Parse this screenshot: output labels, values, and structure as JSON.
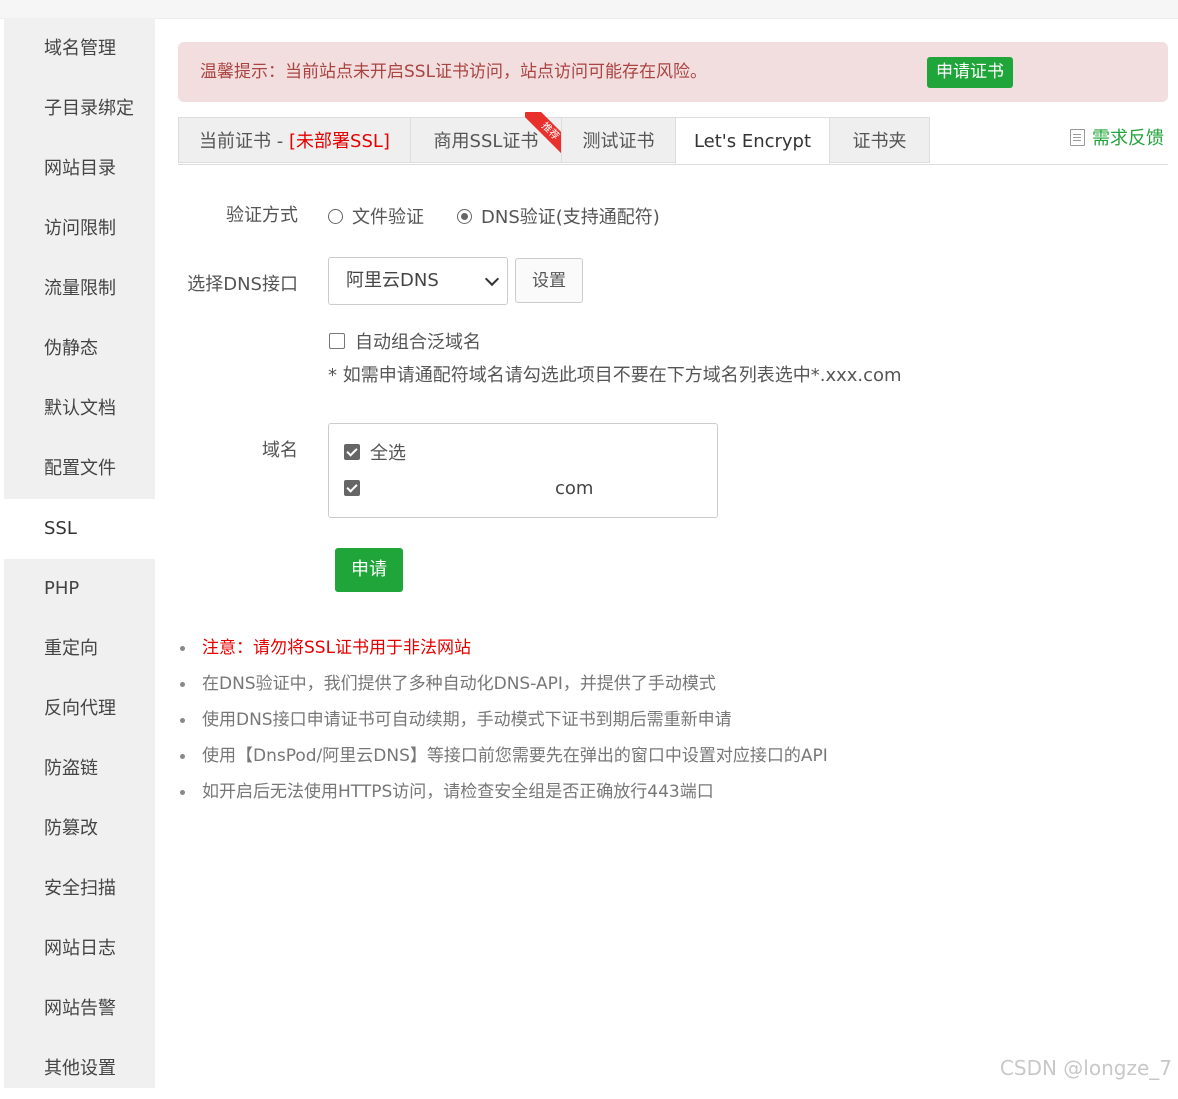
{
  "sidebar": {
    "items": [
      {
        "label": "域名管理"
      },
      {
        "label": "子目录绑定"
      },
      {
        "label": "网站目录"
      },
      {
        "label": "访问限制"
      },
      {
        "label": "流量限制"
      },
      {
        "label": "伪静态"
      },
      {
        "label": "默认文档"
      },
      {
        "label": "配置文件"
      },
      {
        "label": "SSL"
      },
      {
        "label": "PHP"
      },
      {
        "label": "重定向"
      },
      {
        "label": "反向代理"
      },
      {
        "label": "防盗链"
      },
      {
        "label": "防篡改"
      },
      {
        "label": "安全扫描"
      },
      {
        "label": "网站日志"
      },
      {
        "label": "网站告警"
      },
      {
        "label": "其他设置"
      }
    ],
    "active": "SSL"
  },
  "alert": {
    "text": "温馨提示：当前站点未开启SSL证书访问，站点访问可能存在风险。",
    "button": "申请证书"
  },
  "tabs": {
    "current_prefix": "当前证书 - ",
    "current_status": "[未部署SSL]",
    "commercial": "商用SSL证书",
    "commercial_badge": "推荐",
    "test": "测试证书",
    "letsencrypt": "Let's Encrypt",
    "folder": "证书夹",
    "active": "Let's Encrypt"
  },
  "feedback": {
    "label": "需求反馈",
    "icon": "edit-icon"
  },
  "form": {
    "verify_label": "验证方式",
    "verify_options": [
      {
        "label": "文件验证",
        "checked": false
      },
      {
        "label": "DNS验证(支持通配符)",
        "checked": true
      }
    ],
    "dns_label": "选择DNS接口",
    "dns_selected": "阿里云DNS",
    "dns_setting_button": "设置",
    "auto_combine_label": "自动组合泛域名",
    "auto_combine_checked": false,
    "hint": "* 如需申请通配符域名请勾选此项目不要在下方域名列表选中*.xxx.com",
    "domain_label": "域名",
    "select_all_label": "全选",
    "select_all_checked": true,
    "domain_item": "com",
    "domain_item_checked": true,
    "apply_button": "申请"
  },
  "notes": [
    "注意：请勿将SSL证书用于非法网站",
    "在DNS验证中，我们提供了多种自动化DNS-API，并提供了手动模式",
    "使用DNS接口申请证书可自动续期，手动模式下证书到期后需重新申请",
    "使用【DnsPod/阿里云DNS】等接口前您需要先在弹出的窗口中设置对应接口的API",
    "如开启后无法使用HTTPS访问，请检查安全组是否正确放行443端口"
  ],
  "watermark": "CSDN @longze_7",
  "colors": {
    "accent": "#20a53a",
    "alert_bg": "#f2dede",
    "alert_text": "#a94442",
    "warning": "#e60000"
  }
}
